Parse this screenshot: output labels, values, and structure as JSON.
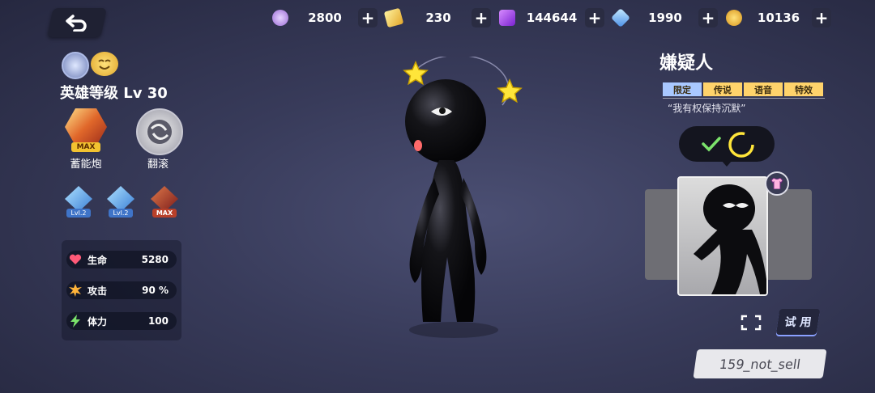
{
  "currencies": [
    {
      "icon": "purple-orb-icon",
      "value": "2800"
    },
    {
      "icon": "gold-ticket-icon",
      "value": "230"
    },
    {
      "icon": "purple-cube-icon",
      "value": "144644"
    },
    {
      "icon": "blue-crystal-icon",
      "value": "1990"
    },
    {
      "icon": "gold-coin-icon",
      "value": "10136"
    }
  ],
  "hero": {
    "level_text": "英雄等级 Lv 30",
    "skills": [
      {
        "label": "蓄能炮",
        "badge": "MAX"
      },
      {
        "label": "翻滚"
      }
    ],
    "upgrades": [
      {
        "badge": "Lvl.2"
      },
      {
        "badge": "Lvl.2"
      },
      {
        "badge": "MAX"
      }
    ],
    "stats": [
      {
        "name": "生命",
        "value": "5280",
        "icon": "heart-icon"
      },
      {
        "name": "攻击",
        "value": "90 %",
        "icon": "explosion-icon"
      },
      {
        "name": "体力",
        "value": "100",
        "icon": "lightning-icon"
      }
    ]
  },
  "character": {
    "name": "嫌疑人",
    "tags": [
      "限定",
      "传说",
      "语音",
      "特效"
    ],
    "quote": "“我有权保持沉默”",
    "try_label": "试 用",
    "id_label": "159_not_sell"
  },
  "colors": {
    "tag_colors": [
      "#a9c8ff",
      "#ffd36b",
      "#ffd36b",
      "#ffd36b"
    ],
    "accent_green": "#7be36b"
  }
}
